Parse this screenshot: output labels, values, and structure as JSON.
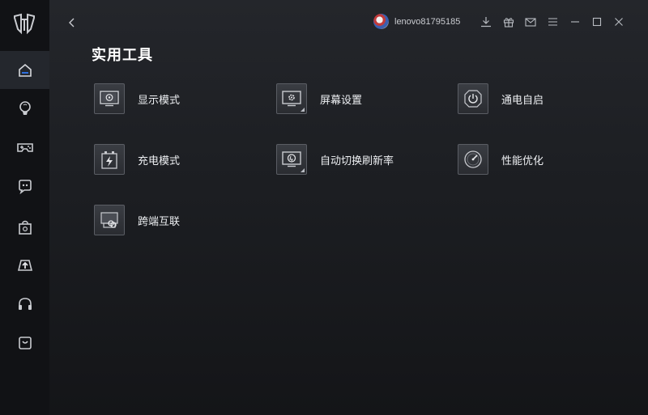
{
  "header": {
    "username": "lenovo81795185"
  },
  "page": {
    "title": "实用工具"
  },
  "sidebar": {
    "items": [
      {
        "name": "home",
        "icon": "home-icon",
        "active": true
      },
      {
        "name": "lighting",
        "icon": "bulb-icon"
      },
      {
        "name": "game",
        "icon": "gamepad-icon"
      },
      {
        "name": "chat",
        "icon": "chat-icon"
      },
      {
        "name": "store",
        "icon": "bag-icon"
      },
      {
        "name": "upload",
        "icon": "upload-icon"
      },
      {
        "name": "headset",
        "icon": "headset-icon"
      },
      {
        "name": "shop",
        "icon": "shop-icon"
      }
    ]
  },
  "tools": [
    {
      "label": "显示模式",
      "icon": "display-mode-icon"
    },
    {
      "label": "屏幕设置",
      "icon": "screen-settings-icon"
    },
    {
      "label": "通电自启",
      "icon": "power-on-icon"
    },
    {
      "label": "充电模式",
      "icon": "charge-mode-icon"
    },
    {
      "label": "自动切换刷新率",
      "icon": "refresh-rate-icon"
    },
    {
      "label": "性能优化",
      "icon": "performance-icon"
    },
    {
      "label": "跨端互联",
      "icon": "cross-device-icon"
    }
  ],
  "colors": {
    "accent": "#2f6fe0",
    "background": "#15171b",
    "sidebar": "#111215"
  }
}
